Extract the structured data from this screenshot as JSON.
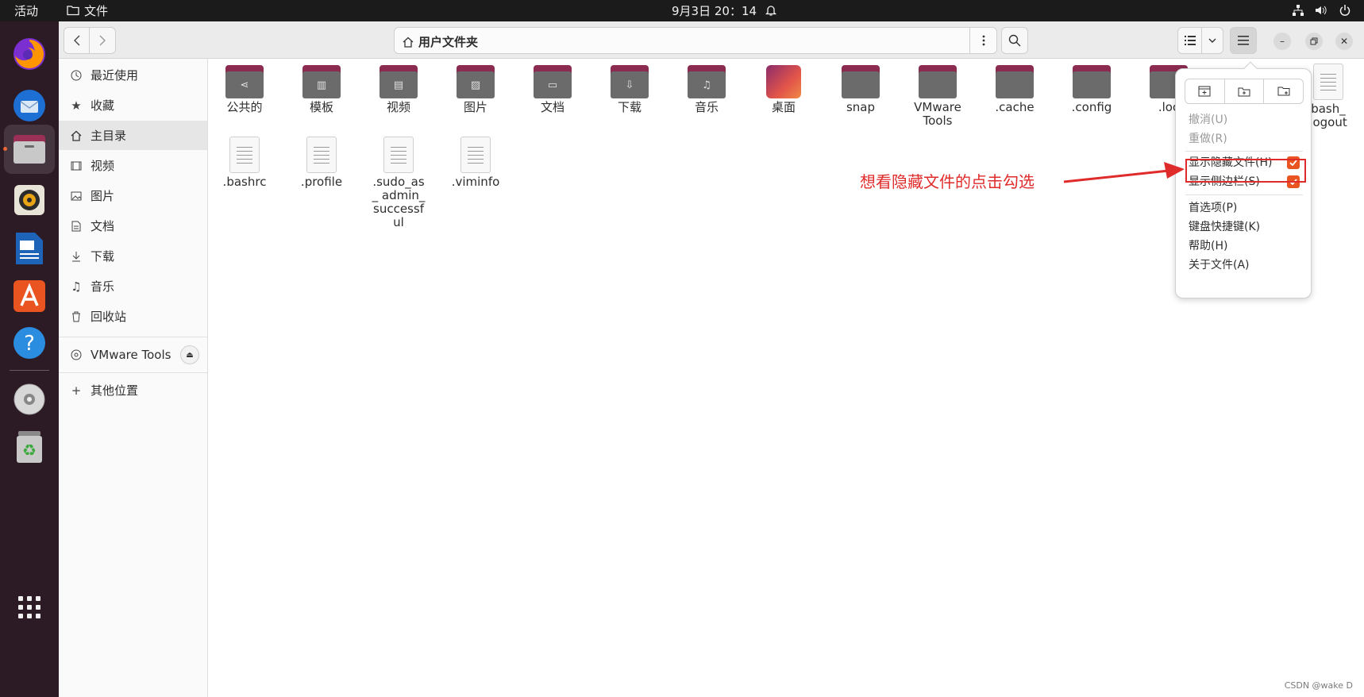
{
  "topbar": {
    "activities": "活动",
    "app_name": "文件",
    "datetime": "9月3日 20：14"
  },
  "window": {
    "location": "用户文件夹"
  },
  "sidebar": {
    "items": [
      {
        "label": "最近使用",
        "icon": "clock-icon"
      },
      {
        "label": "收藏",
        "icon": "star-icon"
      },
      {
        "label": "主目录",
        "icon": "home-icon"
      },
      {
        "label": "视频",
        "icon": "video-icon"
      },
      {
        "label": "图片",
        "icon": "image-icon"
      },
      {
        "label": "文档",
        "icon": "document-icon"
      },
      {
        "label": "下载",
        "icon": "download-icon"
      },
      {
        "label": "音乐",
        "icon": "music-icon"
      },
      {
        "label": "回收站",
        "icon": "trash-icon"
      }
    ],
    "device": "VMware Tools",
    "other": "其他位置"
  },
  "files": [
    {
      "label": "公共的",
      "kind": "folder",
      "glyph": "share"
    },
    {
      "label": "模板",
      "kind": "folder",
      "glyph": "template"
    },
    {
      "label": "视频",
      "kind": "folder",
      "glyph": "video"
    },
    {
      "label": "图片",
      "kind": "folder",
      "glyph": "image"
    },
    {
      "label": "文档",
      "kind": "folder",
      "glyph": "document"
    },
    {
      "label": "下载",
      "kind": "folder",
      "glyph": "download"
    },
    {
      "label": "音乐",
      "kind": "folder",
      "glyph": "music"
    },
    {
      "label": "桌面",
      "kind": "desktop"
    },
    {
      "label": "snap",
      "kind": "folder"
    },
    {
      "label": "VMware Tools",
      "kind": "folder"
    },
    {
      "label": ".cache",
      "kind": "folder"
    },
    {
      "label": ".config",
      "kind": "folder"
    },
    {
      "label": ".loc",
      "kind": "folder"
    },
    {
      "label": "bash_ logout",
      "kind": "doc"
    },
    {
      "label": ".bashrc",
      "kind": "doc"
    },
    {
      "label": ".profile",
      "kind": "doc"
    },
    {
      "label": ".sudo_as_ admin_ successful",
      "kind": "doc"
    },
    {
      "label": ".viminfo",
      "kind": "doc"
    }
  ],
  "menu": {
    "undo": "撤消(U)",
    "redo": "重做(R)",
    "show_hidden": "显示隐藏文件(H)",
    "show_sidebar": "显示侧边栏(S)",
    "preferences": "首选项(P)",
    "shortcuts": "键盘快捷键(K)",
    "help": "帮助(H)",
    "about": "关于文件(A)",
    "show_hidden_checked": true,
    "show_sidebar_checked": true
  },
  "annotation": "想看隐藏文件的点击勾选",
  "watermark": "CSDN @wake D",
  "colors": {
    "accent": "#e95420",
    "annotation": "#e02b2b",
    "dock": "#2c1a24",
    "topbar": "#1b1b1b"
  }
}
